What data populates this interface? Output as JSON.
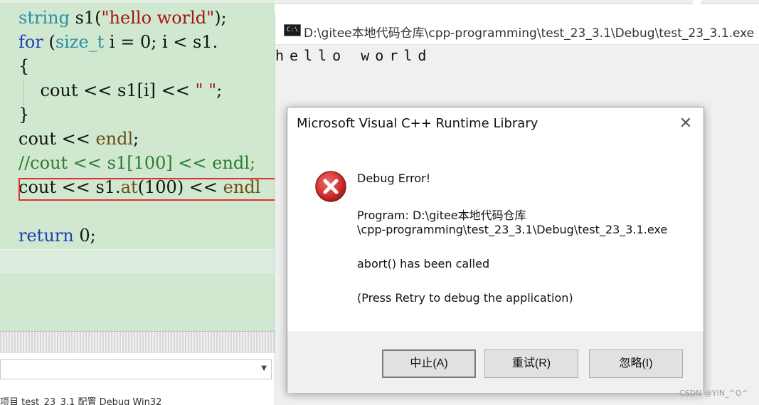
{
  "editor": {
    "lines": [
      {
        "parts": [
          {
            "c": "ty",
            "t": "string"
          },
          {
            "c": "pl",
            "t": " s1("
          },
          {
            "c": "str",
            "t": "\"hello world\""
          },
          {
            "c": "pl",
            "t": ");"
          }
        ]
      },
      {
        "parts": [
          {
            "c": "kw",
            "t": "for"
          },
          {
            "c": "pl",
            "t": " ("
          },
          {
            "c": "ty",
            "t": "size_t"
          },
          {
            "c": "pl",
            "t": " i = 0; i < s1."
          }
        ]
      },
      {
        "parts": [
          {
            "c": "pl",
            "t": "{"
          }
        ]
      },
      {
        "parts": [
          {
            "c": "pl",
            "t": "    cout "
          },
          {
            "c": "pl",
            "t": "<< "
          },
          {
            "c": "pl",
            "t": "s1[i] << "
          },
          {
            "c": "str",
            "t": "\" \""
          },
          {
            "c": "pl",
            "t": ";"
          }
        ]
      },
      {
        "parts": [
          {
            "c": "pl",
            "t": "}"
          }
        ]
      },
      {
        "parts": [
          {
            "c": "pl",
            "t": "cout << "
          },
          {
            "c": "fn",
            "t": "endl"
          },
          {
            "c": "pl",
            "t": ";"
          }
        ]
      },
      {
        "parts": [
          {
            "c": "cm",
            "t": "//cout << s1[100] << endl;"
          }
        ]
      },
      {
        "parts": [
          {
            "c": "pl",
            "t": "cout << s1."
          },
          {
            "c": "fn",
            "t": "at"
          },
          {
            "c": "pl",
            "t": "(100) << "
          },
          {
            "c": "fn",
            "t": "endl"
          }
        ]
      },
      {
        "parts": []
      },
      {
        "parts": [
          {
            "c": "kw",
            "t": "return"
          },
          {
            "c": "pl",
            "t": " 0;"
          }
        ]
      }
    ],
    "status_text": "项目 test_23_3.1 配置 Debug Win32"
  },
  "console": {
    "icon_text": "C:\\",
    "title": "D:\\gitee本地代码仓库\\cpp-programming\\test_23_3.1\\Debug\\test_23_3.1.exe",
    "output": "hello world"
  },
  "dialog": {
    "title": "Microsoft Visual C++ Runtime Library",
    "heading": "Debug Error!",
    "program_line1": "Program: D:\\gitee本地代码仓库",
    "program_line2": "\\cpp-programming\\test_23_3.1\\Debug\\test_23_3.1.exe",
    "message": "abort() has been called",
    "hint": "(Press Retry to debug the application)",
    "buttons": {
      "abort": "中止(A)",
      "retry": "重试(R)",
      "ignore": "忽略(I)"
    }
  },
  "watermark": "CSDN @YIN_^O^",
  "colors": {
    "editor_bg": "#cfe8cf",
    "keyword": "#1f3fb7",
    "type": "#2b8fa6",
    "string": "#a31515",
    "comment": "#2e7d32",
    "highlight_box": "#e03030",
    "error_icon": "#d32f2f"
  }
}
